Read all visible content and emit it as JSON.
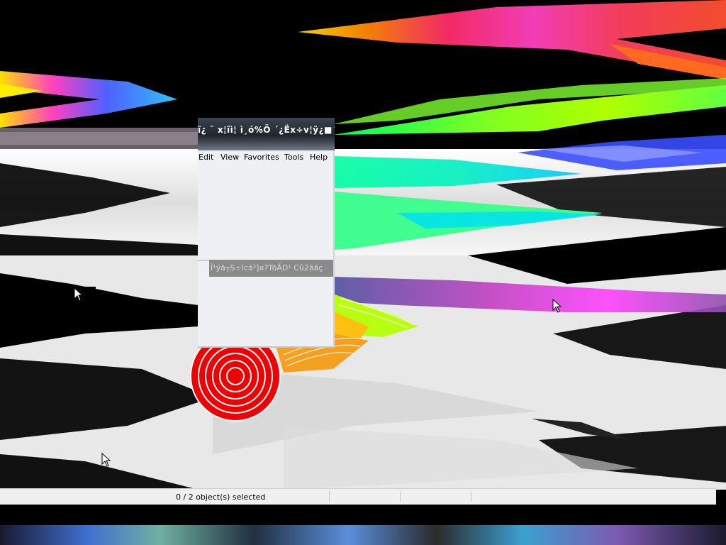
{
  "window": {
    "title": "ï¿ ¯ x¦ïì¦ ì¸ó%Ö ´¿Ëx÷v¦ÿ¿■´ó¤",
    "menu": [
      "Edit",
      "View",
      "Favorites",
      "Tools",
      "Help"
    ],
    "garbled_bar_text": "Ï¹ÿä┬S÷Icá³]¤?TöÄD¹ Cû2ääç"
  },
  "statusbar": {
    "selection_text": "0 / 2 object(s) selected"
  },
  "colors": {
    "glitch_rainbow": [
      "#ff2d2d",
      "#ff8c00",
      "#ffee00",
      "#7cff00",
      "#00ffb0",
      "#00c8ff",
      "#3a4cff",
      "#c040ff",
      "#ff40c0"
    ],
    "target_red": "#ee0000",
    "target_ring": "#ffffff",
    "orange_rings": "#f4a020"
  },
  "icons": {
    "cursor": "mouse-pointer-icon",
    "target": "concentric-target-icon"
  }
}
